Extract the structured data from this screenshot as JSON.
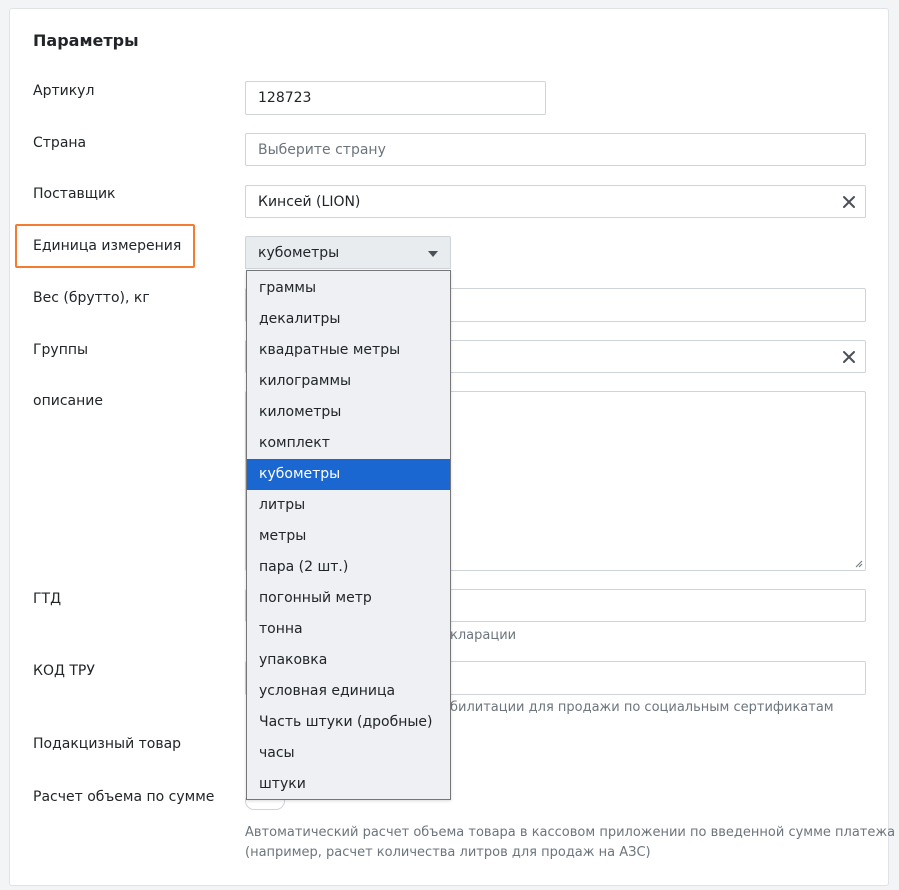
{
  "section": {
    "title": "Параметры"
  },
  "fields": {
    "article": {
      "label": "Артикул",
      "value": "128723"
    },
    "country": {
      "label": "Страна",
      "placeholder": "Выберите страну"
    },
    "supplier": {
      "label": "Поставщик",
      "value": "Кинсей (LION)"
    },
    "unit": {
      "label": "Единица измерения",
      "value": "кубометры"
    },
    "weight": {
      "label": "Вес (брутто), кг"
    },
    "groups": {
      "label": "Группы"
    },
    "description": {
      "label": "описание"
    },
    "gtd": {
      "label": "ГТД",
      "hint_visible": "кларации"
    },
    "tru": {
      "label": "КОД ТРУ",
      "hint_visible": "билитации для продажи по социальным сертификатам"
    },
    "excise": {
      "label": "Подакцизный товар"
    },
    "volume_by_sum": {
      "label": "Расчет объема по сумме",
      "hint_line1": "Автоматический расчет объема товара в кассовом приложении по введенной сумме платежа",
      "hint_line2": "(например, расчет количества литров для продаж на АЗС)"
    }
  },
  "unit_options": [
    "граммы",
    "декалитры",
    "квадратные метры",
    "килограммы",
    "километры",
    "комплект",
    "кубометры",
    "литры",
    "метры",
    "пара (2 шт.)",
    "погонный метр",
    "тонна",
    "упаковка",
    "условная единица",
    "Часть штуки (дробные)",
    "часы",
    "штуки"
  ],
  "selected_option": "кубометры",
  "colors": {
    "highlight": "#f47c30",
    "selected_bg": "#1a67d2"
  }
}
